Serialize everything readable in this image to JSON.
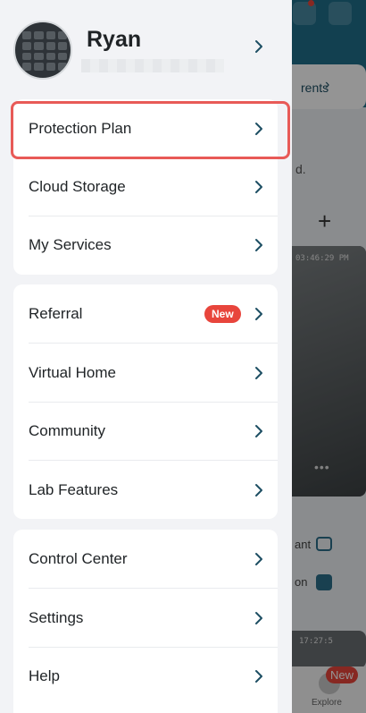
{
  "profile": {
    "name": "Ryan"
  },
  "menu": {
    "card1": [
      {
        "label": "Protection Plan"
      },
      {
        "label": "Cloud Storage"
      },
      {
        "label": "My Services"
      }
    ],
    "card2": [
      {
        "label": "Referral",
        "badge": "New"
      },
      {
        "label": "Virtual Home"
      },
      {
        "label": "Community"
      },
      {
        "label": "Lab Features"
      }
    ],
    "card3": [
      {
        "label": "Control Center"
      },
      {
        "label": "Settings"
      },
      {
        "label": "Help"
      }
    ]
  },
  "background": {
    "events_text": "rents",
    "body_text": "d.",
    "plus": "+",
    "timestamp_1": "03:46:29 PM",
    "dots": "•••",
    "row1": "ant",
    "row2": "on",
    "timestamp_2": "17:27:5",
    "tab_explore": "Explore",
    "tab_badge": "New"
  },
  "colors": {
    "highlight": "#e85a57",
    "badge": "#e8453c",
    "chevron": "#1d4e63"
  }
}
